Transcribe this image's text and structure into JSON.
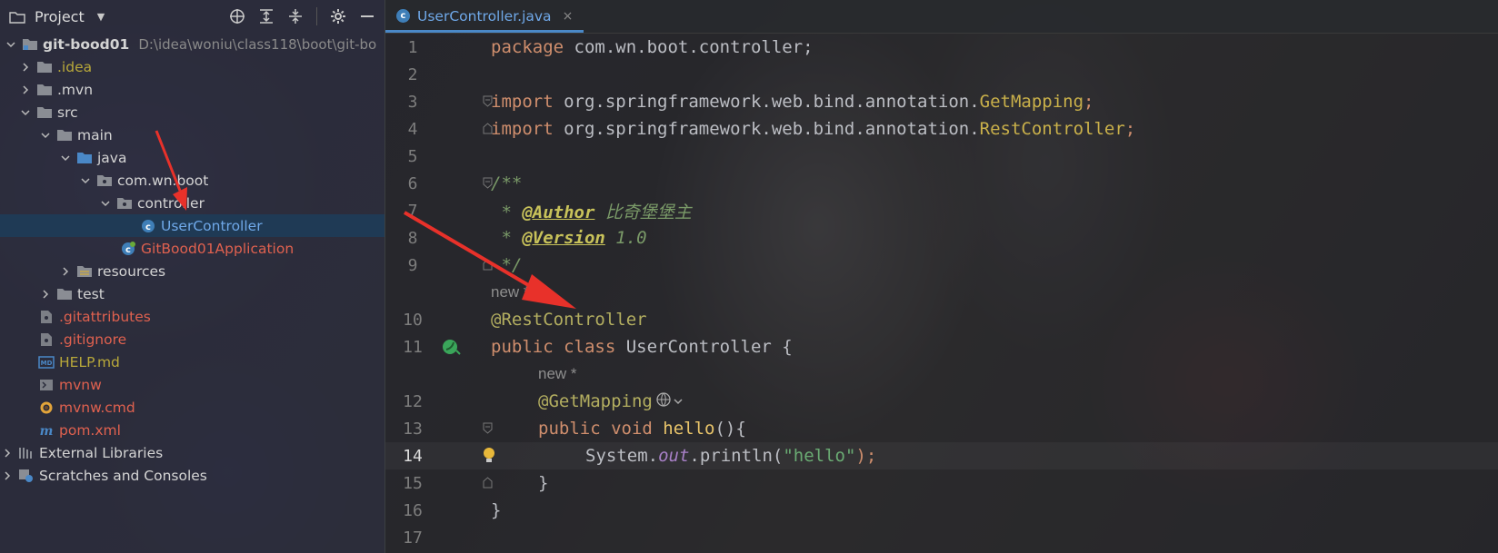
{
  "project_panel": {
    "title": "Project",
    "tools": [
      "locate-icon",
      "expand-all-icon",
      "collapse-all-icon",
      "gear-icon",
      "minimize-icon"
    ],
    "tree": [
      {
        "label": "git-bood01",
        "path": "D:\\idea\\woniu\\class118\\boot\\git-bo"
      },
      {
        "label": ".idea"
      },
      {
        "label": ".mvn"
      },
      {
        "label": "src"
      },
      {
        "label": "main"
      },
      {
        "label": "java"
      },
      {
        "label": "com.wn.boot"
      },
      {
        "label": "controller"
      },
      {
        "label": "UserController"
      },
      {
        "label": "GitBood01Application"
      },
      {
        "label": "resources"
      },
      {
        "label": "test"
      },
      {
        "label": ".gitattributes"
      },
      {
        "label": ".gitignore"
      },
      {
        "label": "HELP.md"
      },
      {
        "label": "mvnw"
      },
      {
        "label": "mvnw.cmd"
      },
      {
        "label": "pom.xml"
      },
      {
        "label": "External Libraries"
      },
      {
        "label": "Scratches and Consoles"
      }
    ]
  },
  "editor": {
    "tab": {
      "label": "UserController.java",
      "close": "×"
    },
    "lines": {
      "l1": {
        "num": "1",
        "kw": "package",
        "rest": " com.wn.boot.controller;"
      },
      "l2": {
        "num": "2"
      },
      "l3": {
        "num": "3",
        "kw": "import",
        "rest": " org.springframework.web.bind.annotation.",
        "cls": "GetMapping",
        "end": ";"
      },
      "l4": {
        "num": "4",
        "kw": "import",
        "rest": " org.springframework.web.bind.annotation.",
        "cls": "RestController",
        "end": ";"
      },
      "l5": {
        "num": "5"
      },
      "l6": {
        "num": "6",
        "text": "/**"
      },
      "l7": {
        "num": "7",
        "star": " * ",
        "tag": "@Author",
        "val": " 比奇堡堡主"
      },
      "l8": {
        "num": "8",
        "star": " * ",
        "tag": "@Version",
        "val": " 1.0"
      },
      "l9": {
        "num": "9",
        "text": " */"
      },
      "hint1": "new *",
      "l10": {
        "num": "10",
        "text": "@RestController"
      },
      "l11": {
        "num": "11",
        "kw1": "public",
        "kw2": " class",
        "rest": " UserController {"
      },
      "hint2": "new *",
      "l12": {
        "num": "12",
        "text": "@GetMapping"
      },
      "l13": {
        "num": "13",
        "kw1": "public",
        "kw2": " void",
        "fn": " hello",
        "rest": "(){"
      },
      "l14": {
        "num": "14",
        "pre": "System.",
        "out": "out",
        "mid": ".println(",
        "str": "\"hello\"",
        "end": ");"
      },
      "l15": {
        "num": "15",
        "text": "}"
      },
      "l16": {
        "num": "16",
        "text": "}"
      },
      "l17": {
        "num": "17"
      }
    }
  }
}
